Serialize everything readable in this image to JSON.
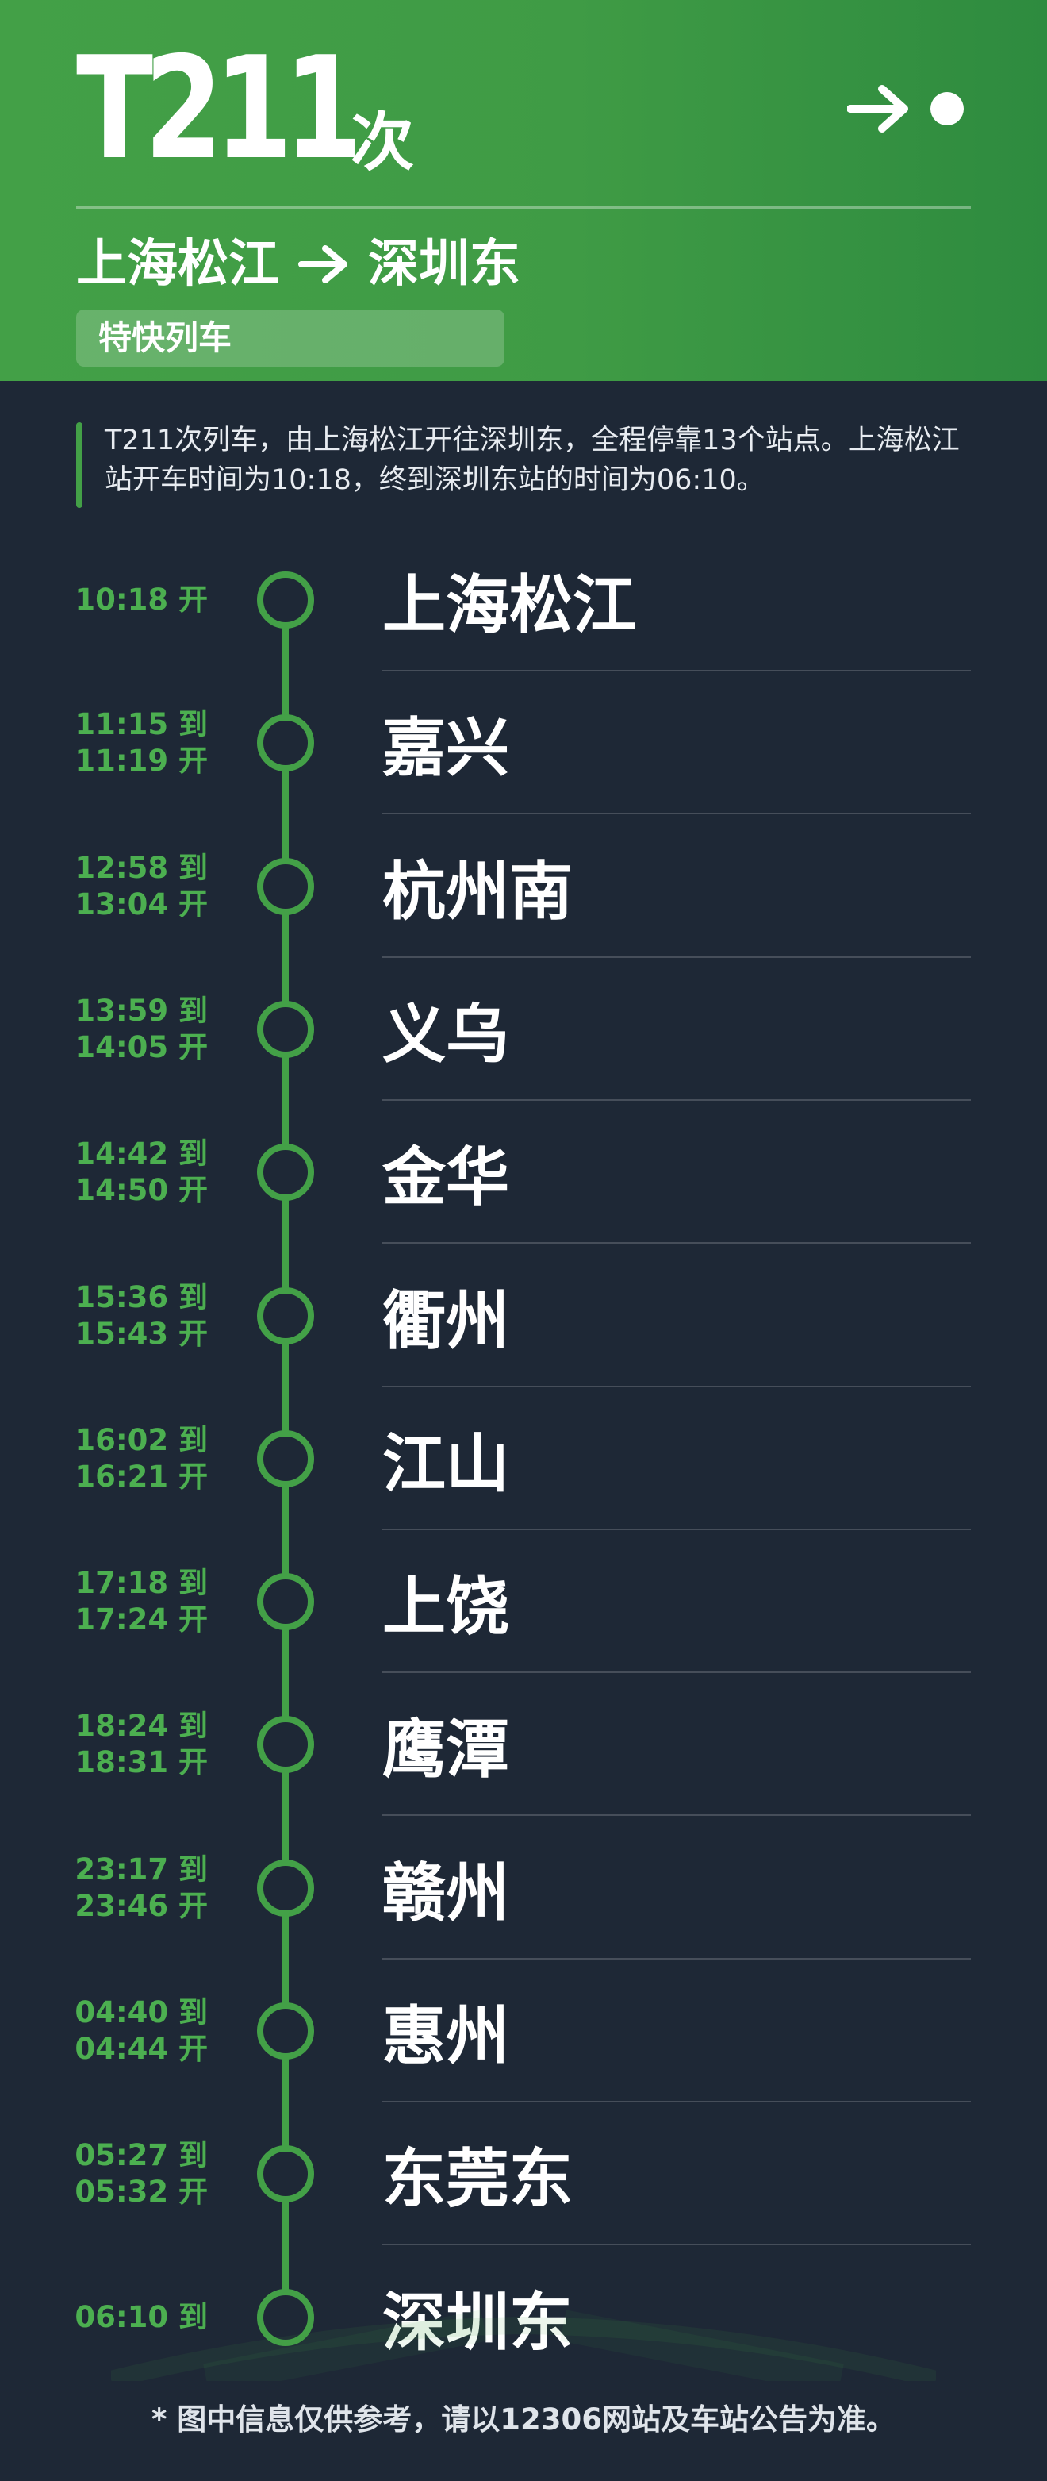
{
  "header": {
    "train_number": "T211",
    "train_suffix": "次",
    "route_from": "上海松江",
    "route_to": "深圳东",
    "train_type": "特快列车",
    "accent_color": "#43a047",
    "arrow_icon": "arrow-right-icon"
  },
  "description": "T211次列车，由上海松江开往深圳东，全程停靠13个站点。上海松江站开车时间为10:18，终到深圳东站的时间为06:10。",
  "stops": [
    {
      "station": "上海松江",
      "arrive": "",
      "depart": "10:18 开"
    },
    {
      "station": "嘉兴",
      "arrive": "11:15 到",
      "depart": "11:19 开"
    },
    {
      "station": "杭州南",
      "arrive": "12:58 到",
      "depart": "13:04 开"
    },
    {
      "station": "义乌",
      "arrive": "13:59 到",
      "depart": "14:05 开"
    },
    {
      "station": "金华",
      "arrive": "14:42 到",
      "depart": "14:50 开"
    },
    {
      "station": "衢州",
      "arrive": "15:36 到",
      "depart": "15:43 开"
    },
    {
      "station": "江山",
      "arrive": "16:02 到",
      "depart": "16:21 开"
    },
    {
      "station": "上饶",
      "arrive": "17:18 到",
      "depart": "17:24 开"
    },
    {
      "station": "鹰潭",
      "arrive": "18:24 到",
      "depart": "18:31 开"
    },
    {
      "station": "赣州",
      "arrive": "23:17 到",
      "depart": "23:46 开"
    },
    {
      "station": "惠州",
      "arrive": "04:40 到",
      "depart": "04:44 开"
    },
    {
      "station": "东莞东",
      "arrive": "05:27 到",
      "depart": "05:32 开"
    },
    {
      "station": "深圳东",
      "arrive": "06:10 到",
      "depart": ""
    }
  ],
  "footer_note": "* 图中信息仅供参考，请以12306网站及车站公告为准。"
}
